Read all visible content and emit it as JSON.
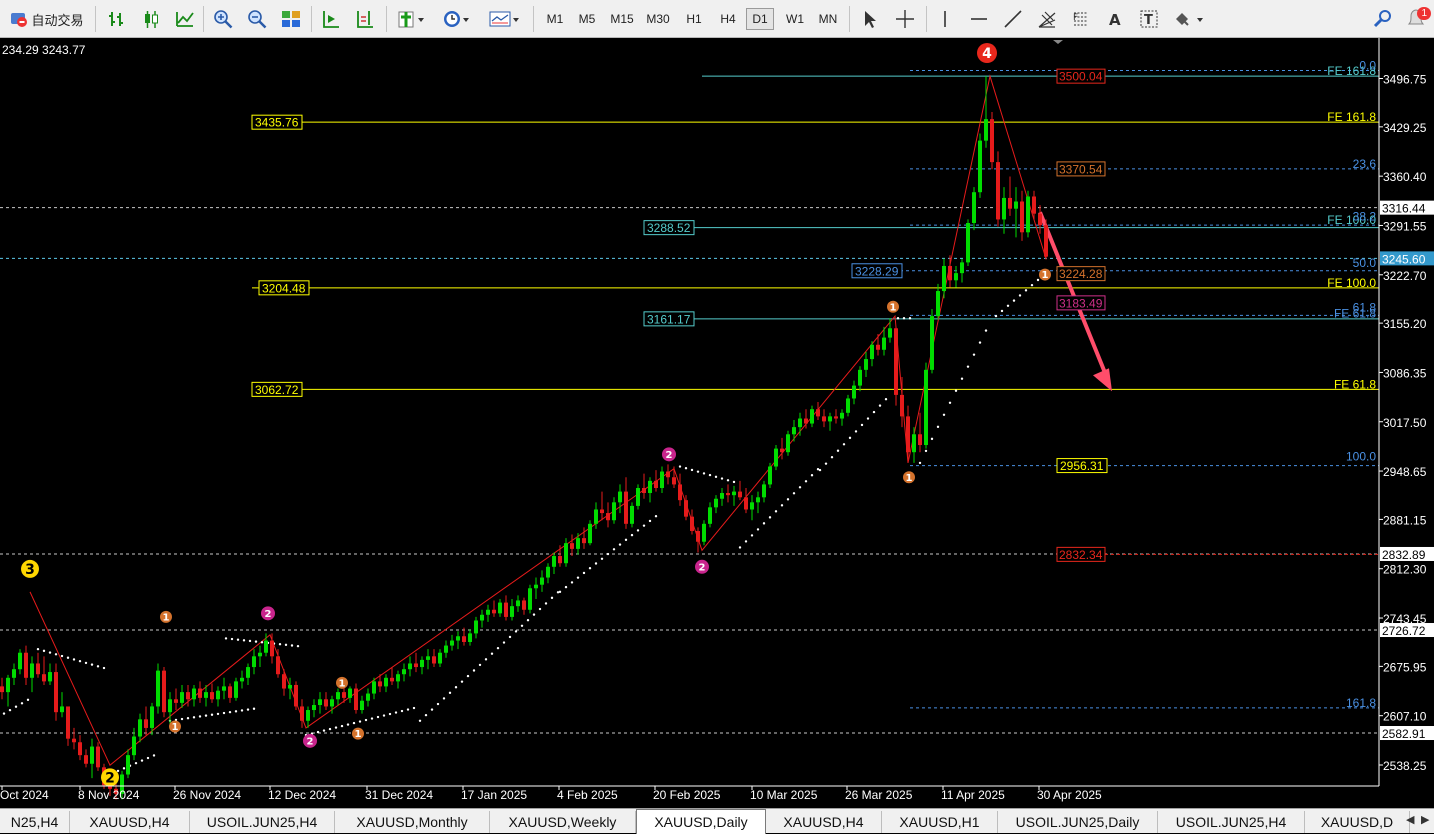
{
  "toolbar": {
    "auto_trade_label": "自动交易",
    "timeframes": [
      "M1",
      "M5",
      "M15",
      "M30",
      "H1",
      "H4",
      "D1",
      "W1",
      "MN"
    ],
    "active_timeframe": "D1",
    "notification_count": "1",
    "icons": [
      "bar-chart-icon",
      "candlestick-icon",
      "line-chart-icon",
      "zoom-in-icon",
      "zoom-out-icon",
      "tile-windows-icon",
      "autoscroll-icon",
      "chart-shift-icon",
      "indicators-icon",
      "periods-icon",
      "templates-icon",
      "cursor-icon",
      "crosshair-icon",
      "vertical-line-icon",
      "horizontal-line-icon",
      "trendline-icon",
      "fib-fan-icon",
      "fibonacci-icon",
      "text-icon",
      "text-label-icon",
      "arrow-objects-icon",
      "search-icon"
    ]
  },
  "chart": {
    "header_text": "234.29 3243.77",
    "price_axis": [
      {
        "label": "3496.75",
        "value": 3496.75
      },
      {
        "label": "3429.25",
        "value": 3429.25
      },
      {
        "label": "3360.40",
        "value": 3360.4
      },
      {
        "label": "3291.55",
        "value": 3291.55
      },
      {
        "label": "3222.70",
        "value": 3222.7
      },
      {
        "label": "3155.20",
        "value": 3155.2
      },
      {
        "label": "3086.35",
        "value": 3086.35
      },
      {
        "label": "3017.50",
        "value": 3017.5
      },
      {
        "label": "2948.65",
        "value": 2948.65
      },
      {
        "label": "2881.15",
        "value": 2881.15
      },
      {
        "label": "2812.30",
        "value": 2812.3
      },
      {
        "label": "2743.45",
        "value": 2743.45
      },
      {
        "label": "2675.95",
        "value": 2675.95
      },
      {
        "label": "2607.10",
        "value": 2607.1
      },
      {
        "label": "2538.25",
        "value": 2538.25
      }
    ],
    "price_markers": [
      {
        "label": "3316.44",
        "value": 3316.44
      },
      {
        "label": "3245.60",
        "value": 3245.6
      },
      {
        "label": "2832.89",
        "value": 2832.89
      },
      {
        "label": "2726.72",
        "value": 2726.72
      },
      {
        "label": "2582.91",
        "value": 2582.91
      }
    ],
    "date_axis": [
      "Oct 2024",
      "8 Nov 2024",
      "26 Nov 2024",
      "12 Dec 2024",
      "31 Dec 2024",
      "17 Jan 2025",
      "4 Feb 2025",
      "20 Feb 2025",
      "10 Mar 2025",
      "26 Mar 2025",
      "11 Apr 2025",
      "30 Apr 2025"
    ],
    "yellow_levels": [
      {
        "label": "3435.76",
        "value": 3435.76
      },
      {
        "label": "3204.48",
        "value": 3204.48
      },
      {
        "label": "3062.72",
        "value": 3062.72
      },
      {
        "label": "2956.31",
        "value": 2956.31
      }
    ],
    "teal_levels": [
      {
        "label": "3288.52",
        "value": 3288.52
      },
      {
        "label": "3161.17",
        "value": 3161.17
      }
    ],
    "blue_levels": [
      {
        "label": "3228.29",
        "value": 3228.29
      }
    ],
    "red_levels": [
      {
        "label": "3500.04",
        "value": 3500.04
      },
      {
        "label": "3370.54",
        "value": 3370.54
      },
      {
        "label": "3224.28",
        "value": 3224.28
      },
      {
        "label": "3183.49",
        "value": 3183.49
      },
      {
        "label": "2832.34",
        "value": 2832.34
      }
    ],
    "fib_right_labels": [
      {
        "label": "FE 161.8",
        "value": 3500.04
      },
      {
        "label": "0.0",
        "value": 3508.0
      },
      {
        "label": "FE 161.8",
        "value": 3435.76
      },
      {
        "label": "23.6",
        "value": 3370.54
      },
      {
        "label": "FE 100.0",
        "value": 3292.0
      },
      {
        "label": "38.2",
        "value": 3297.0
      },
      {
        "label": "50.0",
        "value": 3232.0
      },
      {
        "label": "FE 100.0",
        "value": 3204.48
      },
      {
        "label": "61.8",
        "value": 3170.0
      },
      {
        "label": "FE 61.8",
        "value": 3162.0
      },
      {
        "label": "FE 61.8",
        "value": 3062.72
      },
      {
        "label": "100.0",
        "value": 2962.0
      },
      {
        "label": "161.8",
        "value": 2618.0
      }
    ],
    "wave_labels": [
      {
        "text": "3",
        "color": "#ffd700",
        "size": "big"
      },
      {
        "text": "4",
        "color": "#e8271c",
        "size": "big"
      },
      {
        "text": "2",
        "color": "#ffd700",
        "size": "big"
      },
      {
        "text": "2",
        "color": "#c8248c",
        "size": "small"
      },
      {
        "text": "1",
        "color": "#d4722c",
        "size": "small"
      }
    ]
  },
  "tabs": [
    {
      "label": "N25,H4"
    },
    {
      "label": "XAUUSD,H4"
    },
    {
      "label": "USOIL.JUN25,H4"
    },
    {
      "label": "XAUUSD,Monthly"
    },
    {
      "label": "XAUUSD,Weekly"
    },
    {
      "label": "XAUUSD,Daily",
      "active": true
    },
    {
      "label": "XAUUSD,H4"
    },
    {
      "label": "XAUUSD,H1"
    },
    {
      "label": "USOIL.JUN25,Daily"
    },
    {
      "label": "USOIL.JUN25,H4"
    },
    {
      "label": "XAUUSD,D"
    }
  ],
  "colors": {
    "bull": "#00dd00",
    "bear": "#e61b1b",
    "yellow": "#ffff00",
    "teal": "#55cccc",
    "blue": "#4a90e2",
    "red": "#e8271c",
    "axis": "#ffffff"
  }
}
